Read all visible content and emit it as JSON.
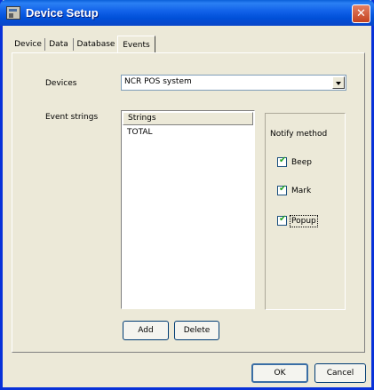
{
  "window": {
    "title": "Device Setup",
    "close_glyph": "✕"
  },
  "tabs": [
    {
      "label": "Device"
    },
    {
      "label": "Data"
    },
    {
      "label": "Database"
    },
    {
      "label": "Events"
    }
  ],
  "devices": {
    "label": "Devices",
    "selected": "NCR POS system"
  },
  "event_strings": {
    "label": "Event strings",
    "header": "Strings",
    "items": [
      "TOTAL"
    ]
  },
  "notify": {
    "title": "Notify method",
    "options": [
      {
        "label": "Beep",
        "checked": true
      },
      {
        "label": "Mark",
        "checked": true
      },
      {
        "label": "Popup",
        "checked": true
      }
    ]
  },
  "buttons": {
    "add": "Add",
    "delete": "Delete",
    "ok": "OK",
    "cancel": "Cancel"
  },
  "icons": {
    "app": "device-setup-icon",
    "close": "close-icon",
    "dropdown": "chevron-down-icon",
    "check": "checkmark-icon"
  }
}
